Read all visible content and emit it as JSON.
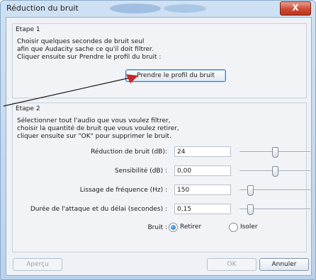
{
  "window": {
    "title": "Réduction du bruit",
    "close_label": "X"
  },
  "etape1": {
    "title": "Etape 1",
    "lines": [
      "Choisir quelques secondes de bruit seul",
      "afin que Audacity sache ce qu'il doit filtrer.",
      "Cliquer ensuite sur Prendre le profil du bruit :"
    ],
    "button": "Prendre le profil du bruit"
  },
  "etape2": {
    "title": "Etape 2",
    "lines": [
      "Sélectionner tout l'audio que vous voulez filtrer,",
      "choisir la quantité de bruit que vous voulez retirer,",
      "cliquer ensuite sur \"OK\" pour supprimer le bruit."
    ],
    "rows": [
      {
        "label": "Réduction de bruit (dB):",
        "value": "24",
        "slider_fraction": 0.5
      },
      {
        "label": "Sensibilité (dB) :",
        "value": "0,00",
        "slider_fraction": 0.5
      },
      {
        "label": "Lissage de fréquence (Hz) :",
        "value": "150",
        "slider_fraction": 0.15
      },
      {
        "label": "Durée de l'attaque et du délai (secondes) :",
        "value": "0,15",
        "slider_fraction": 0.15
      }
    ],
    "bruit_label": "Bruit :",
    "option_retirer": "Retirer",
    "option_isoler": "Isoler",
    "selected_option": "Retirer"
  },
  "footer": {
    "apercu": "Aperçu",
    "ok": "OK",
    "annuler": "Annuler"
  },
  "colors": {
    "title_bar": "#b9d2ec",
    "close": "#cf4a33",
    "arrow": "#c62828"
  }
}
